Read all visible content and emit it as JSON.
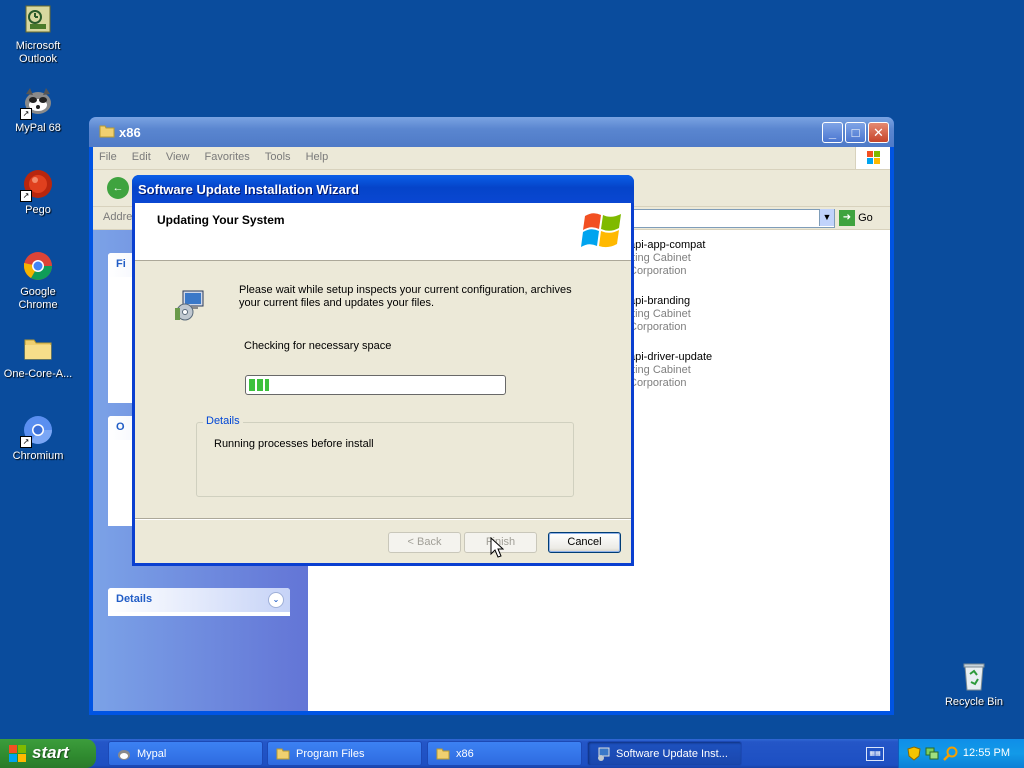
{
  "desktop": {
    "icons": [
      {
        "label": "Microsoft Outlook",
        "icon": "outlook-icon"
      },
      {
        "label": "MyPal 68",
        "icon": "mypal-icon"
      },
      {
        "label": "Pego",
        "icon": "pego-icon"
      },
      {
        "label": "Google Chrome",
        "icon": "chrome-icon"
      },
      {
        "label": "One-Core-A...",
        "icon": "folder-icon"
      },
      {
        "label": "Chromium",
        "icon": "chromium-icon"
      },
      {
        "label": "Recycle Bin",
        "icon": "recycle-bin-icon"
      }
    ]
  },
  "explorer": {
    "title": "x86",
    "menu": [
      "File",
      "Edit",
      "View",
      "Favorites",
      "Tools",
      "Help"
    ],
    "address_label": "Addre",
    "go_label": "Go",
    "side_panels": [
      {
        "label": "Fi"
      },
      {
        "label": "O"
      },
      {
        "label": "Details"
      }
    ],
    "files": [
      {
        "name": "api-app-compat",
        "type": "tting Cabinet",
        "company": "Corporation"
      },
      {
        "name": "api-branding",
        "type": "tting Cabinet",
        "company": "Corporation"
      },
      {
        "name": "api-driver-update",
        "type": "tting Cabinet",
        "company": "Corporation"
      }
    ]
  },
  "wizard": {
    "title": "Software Update Installation Wizard",
    "header_title": "Updating Your System",
    "description": "Please wait while setup inspects your current configuration, archives your current files and updates your files.",
    "status": "Checking for necessary space",
    "progress_fraction": 0.08,
    "details_label": "Details",
    "details_text": "Running processes before install",
    "buttons": {
      "back": "< Back",
      "finish": "Finish",
      "cancel": "Cancel"
    }
  },
  "taskbar": {
    "start_label": "start",
    "tasks": [
      {
        "label": "Mypal",
        "active": false
      },
      {
        "label": "Program Files",
        "active": false
      },
      {
        "label": "x86",
        "active": false
      },
      {
        "label": "Software Update Inst...",
        "active": true
      }
    ],
    "clock": "12:55 PM"
  },
  "colors": {
    "desktop": "#0a4c9d",
    "titlebar": "#0544c9",
    "progress": "#3cc13c"
  }
}
